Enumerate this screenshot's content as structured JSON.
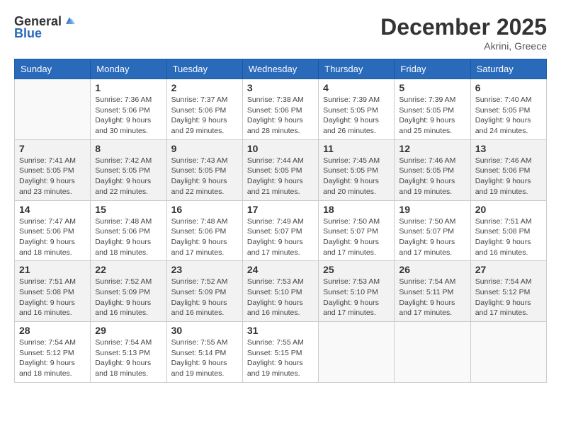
{
  "header": {
    "logo_general": "General",
    "logo_blue": "Blue",
    "month_year": "December 2025",
    "location": "Akrini, Greece"
  },
  "days_of_week": [
    "Sunday",
    "Monday",
    "Tuesday",
    "Wednesday",
    "Thursday",
    "Friday",
    "Saturday"
  ],
  "weeks": [
    {
      "shaded": false,
      "days": [
        {
          "date": "",
          "info": ""
        },
        {
          "date": "1",
          "info": "Sunrise: 7:36 AM\nSunset: 5:06 PM\nDaylight: 9 hours\nand 30 minutes."
        },
        {
          "date": "2",
          "info": "Sunrise: 7:37 AM\nSunset: 5:06 PM\nDaylight: 9 hours\nand 29 minutes."
        },
        {
          "date": "3",
          "info": "Sunrise: 7:38 AM\nSunset: 5:06 PM\nDaylight: 9 hours\nand 28 minutes."
        },
        {
          "date": "4",
          "info": "Sunrise: 7:39 AM\nSunset: 5:05 PM\nDaylight: 9 hours\nand 26 minutes."
        },
        {
          "date": "5",
          "info": "Sunrise: 7:39 AM\nSunset: 5:05 PM\nDaylight: 9 hours\nand 25 minutes."
        },
        {
          "date": "6",
          "info": "Sunrise: 7:40 AM\nSunset: 5:05 PM\nDaylight: 9 hours\nand 24 minutes."
        }
      ]
    },
    {
      "shaded": true,
      "days": [
        {
          "date": "7",
          "info": "Sunrise: 7:41 AM\nSunset: 5:05 PM\nDaylight: 9 hours\nand 23 minutes."
        },
        {
          "date": "8",
          "info": "Sunrise: 7:42 AM\nSunset: 5:05 PM\nDaylight: 9 hours\nand 22 minutes."
        },
        {
          "date": "9",
          "info": "Sunrise: 7:43 AM\nSunset: 5:05 PM\nDaylight: 9 hours\nand 22 minutes."
        },
        {
          "date": "10",
          "info": "Sunrise: 7:44 AM\nSunset: 5:05 PM\nDaylight: 9 hours\nand 21 minutes."
        },
        {
          "date": "11",
          "info": "Sunrise: 7:45 AM\nSunset: 5:05 PM\nDaylight: 9 hours\nand 20 minutes."
        },
        {
          "date": "12",
          "info": "Sunrise: 7:46 AM\nSunset: 5:05 PM\nDaylight: 9 hours\nand 19 minutes."
        },
        {
          "date": "13",
          "info": "Sunrise: 7:46 AM\nSunset: 5:06 PM\nDaylight: 9 hours\nand 19 minutes."
        }
      ]
    },
    {
      "shaded": false,
      "days": [
        {
          "date": "14",
          "info": "Sunrise: 7:47 AM\nSunset: 5:06 PM\nDaylight: 9 hours\nand 18 minutes."
        },
        {
          "date": "15",
          "info": "Sunrise: 7:48 AM\nSunset: 5:06 PM\nDaylight: 9 hours\nand 18 minutes."
        },
        {
          "date": "16",
          "info": "Sunrise: 7:48 AM\nSunset: 5:06 PM\nDaylight: 9 hours\nand 17 minutes."
        },
        {
          "date": "17",
          "info": "Sunrise: 7:49 AM\nSunset: 5:07 PM\nDaylight: 9 hours\nand 17 minutes."
        },
        {
          "date": "18",
          "info": "Sunrise: 7:50 AM\nSunset: 5:07 PM\nDaylight: 9 hours\nand 17 minutes."
        },
        {
          "date": "19",
          "info": "Sunrise: 7:50 AM\nSunset: 5:07 PM\nDaylight: 9 hours\nand 17 minutes."
        },
        {
          "date": "20",
          "info": "Sunrise: 7:51 AM\nSunset: 5:08 PM\nDaylight: 9 hours\nand 16 minutes."
        }
      ]
    },
    {
      "shaded": true,
      "days": [
        {
          "date": "21",
          "info": "Sunrise: 7:51 AM\nSunset: 5:08 PM\nDaylight: 9 hours\nand 16 minutes."
        },
        {
          "date": "22",
          "info": "Sunrise: 7:52 AM\nSunset: 5:09 PM\nDaylight: 9 hours\nand 16 minutes."
        },
        {
          "date": "23",
          "info": "Sunrise: 7:52 AM\nSunset: 5:09 PM\nDaylight: 9 hours\nand 16 minutes."
        },
        {
          "date": "24",
          "info": "Sunrise: 7:53 AM\nSunset: 5:10 PM\nDaylight: 9 hours\nand 16 minutes."
        },
        {
          "date": "25",
          "info": "Sunrise: 7:53 AM\nSunset: 5:10 PM\nDaylight: 9 hours\nand 17 minutes."
        },
        {
          "date": "26",
          "info": "Sunrise: 7:54 AM\nSunset: 5:11 PM\nDaylight: 9 hours\nand 17 minutes."
        },
        {
          "date": "27",
          "info": "Sunrise: 7:54 AM\nSunset: 5:12 PM\nDaylight: 9 hours\nand 17 minutes."
        }
      ]
    },
    {
      "shaded": false,
      "days": [
        {
          "date": "28",
          "info": "Sunrise: 7:54 AM\nSunset: 5:12 PM\nDaylight: 9 hours\nand 18 minutes."
        },
        {
          "date": "29",
          "info": "Sunrise: 7:54 AM\nSunset: 5:13 PM\nDaylight: 9 hours\nand 18 minutes."
        },
        {
          "date": "30",
          "info": "Sunrise: 7:55 AM\nSunset: 5:14 PM\nDaylight: 9 hours\nand 19 minutes."
        },
        {
          "date": "31",
          "info": "Sunrise: 7:55 AM\nSunset: 5:15 PM\nDaylight: 9 hours\nand 19 minutes."
        },
        {
          "date": "",
          "info": ""
        },
        {
          "date": "",
          "info": ""
        },
        {
          "date": "",
          "info": ""
        }
      ]
    }
  ]
}
